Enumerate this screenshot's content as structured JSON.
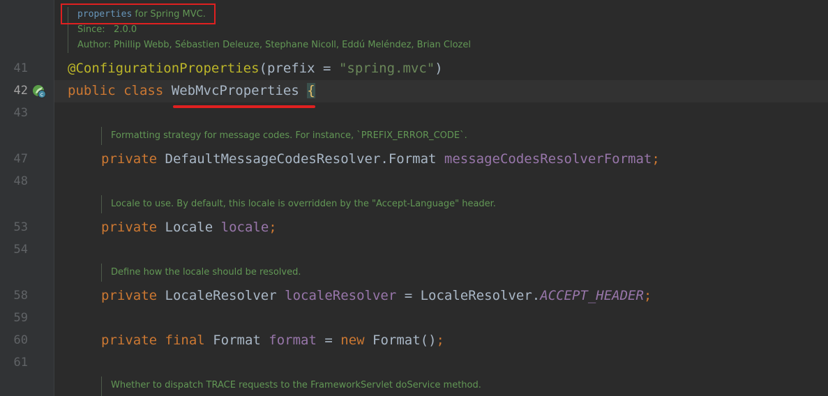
{
  "javadoc_class": {
    "summary_code": "properties",
    "summary_text": " for Spring MVC.",
    "since_label": "Since:",
    "since_value": "2.0.0",
    "author": "Author: Phillip Webb, Sébastien Deleuze, Stephane Nicoll, Eddú Meléndez, Brian Clozel"
  },
  "line_numbers": [
    "41",
    "42",
    "43",
    "47",
    "48",
    "53",
    "54",
    "58",
    "59",
    "60",
    "61"
  ],
  "code": {
    "annotation": "@ConfigurationProperties",
    "annotation_args_open": "(prefix = ",
    "annotation_string": "\"spring.mvc\"",
    "annotation_args_close": ")",
    "class_kw_public": "public",
    "class_kw_class": "class",
    "class_name": "WebMvcProperties",
    "class_brace": "{",
    "field1_doc": "Formatting strategy for message codes. For instance, `PREFIX_ERROR_CODE`.",
    "field1_kw": "private",
    "field1_type": "DefaultMessageCodesResolver.Format",
    "field1_name": "messageCodesResolverFormat",
    "field2_doc": "Locale to use. By default, this locale is overridden by the \"Accept-Language\" header.",
    "field2_kw": "private",
    "field2_type": "Locale",
    "field2_name": "locale",
    "field3_doc": "Define how the locale should be resolved.",
    "field3_kw": "private",
    "field3_type": "LocaleResolver",
    "field3_name": "localeResolver",
    "field3_eq": " = LocaleResolver.",
    "field3_value": "ACCEPT_HEADER",
    "field4_kw_private": "private",
    "field4_kw_final": "final",
    "field4_type": "Format",
    "field4_name": "format",
    "field4_eq": " = ",
    "field4_kw_new": "new",
    "field4_ctor": " Format()",
    "semicolon": ";",
    "field5_doc": "Whether to dispatch TRACE requests to the FrameworkServlet doService method."
  },
  "icons": {
    "gutter_bean": "spring-bean-icon"
  },
  "colors": {
    "highlight": "#e02020",
    "background": "#2b2b2b"
  }
}
